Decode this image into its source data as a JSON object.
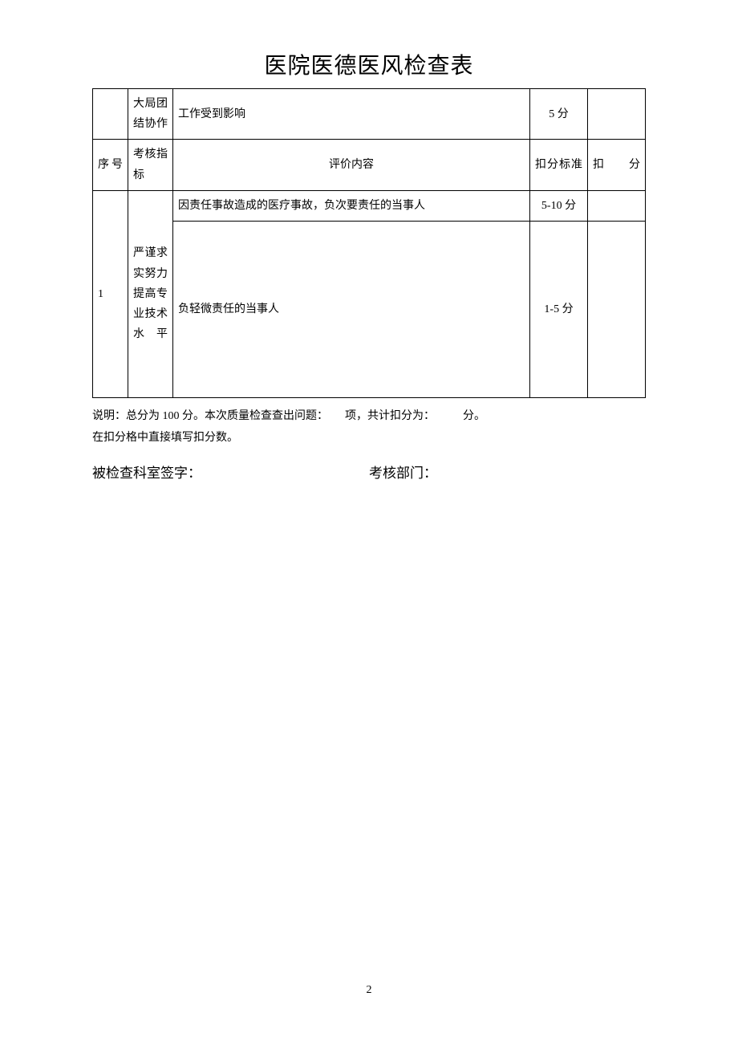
{
  "title": "医院医德医风检查表",
  "header": {
    "col1": "序号",
    "col2": "考核指标",
    "col3": "评价内容",
    "col4": "扣分标准",
    "col5": "扣分"
  },
  "row_top": {
    "indicator": "大局团结协作",
    "content": "工作受到影响",
    "standard": "5 分",
    "deduct": ""
  },
  "row_main": {
    "seq": "1",
    "indicator": "严谨求实努力提高专业技术水平",
    "sub1": {
      "content": "因责任事故造成的医疗事故，负次要责任的当事人",
      "standard": "5-10 分",
      "deduct": ""
    },
    "sub2": {
      "content": "负轻微责任的当事人",
      "standard": "1-5 分",
      "deduct": ""
    }
  },
  "notes_line1": "说明：总分为 100 分。本次质量检查查出问题：　　项，共计扣分为：　　　分。",
  "notes_line2": "在扣分格中直接填写扣分数。",
  "sign_left": "被检查科室签字：",
  "sign_right": "考核部门：",
  "page_number": "2"
}
